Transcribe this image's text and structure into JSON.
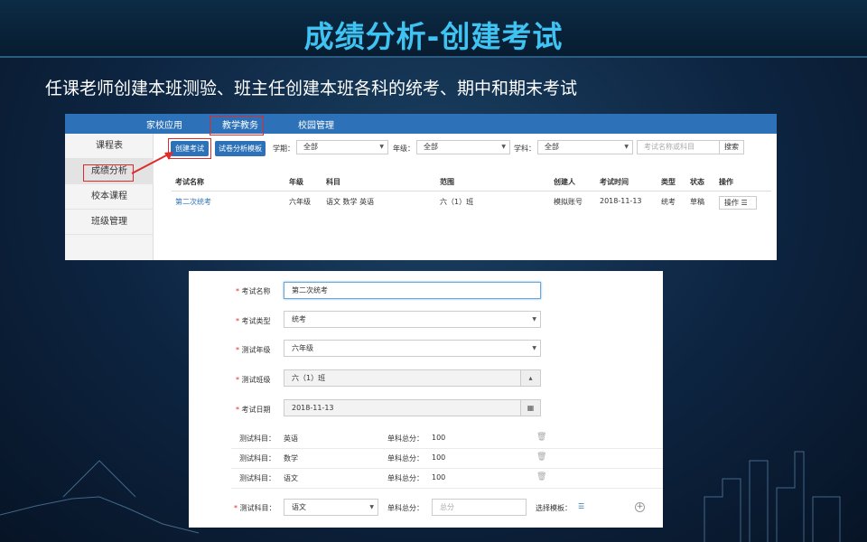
{
  "slide": {
    "title": "成绩分析-创建考试",
    "subtitle": "任课老师创建本班测验、班主任创建本班各科的统考、期中和期末考试"
  },
  "shot1": {
    "nav": [
      "家校应用",
      "教学教务",
      "校园管理"
    ],
    "sidebar": [
      "课程表",
      "成绩分析",
      "校本课程",
      "班级管理"
    ],
    "buttons": {
      "create": "创建考试",
      "template": "试卷分析模板",
      "search": "搜索"
    },
    "filters": {
      "semester_label": "学期：",
      "semester_value": "全部",
      "grade_label": "年级：",
      "grade_value": "全部",
      "subject_label": "学科：",
      "subject_value": "全部",
      "search_placeholder": "考试名称或科目"
    },
    "table": {
      "headers": [
        "考试名称",
        "年级",
        "科目",
        "范围",
        "创建人",
        "考试时间",
        "类型",
        "状态",
        "操作"
      ],
      "rows": [
        [
          "第二次统考",
          "六年级",
          "语文 数学 英语",
          "六（1）班",
          "模拟账号",
          "2018-11-13",
          "统考",
          "草稿"
        ]
      ],
      "op_label": "操作"
    }
  },
  "shot2": {
    "fields": [
      {
        "label": "考试名称",
        "value": "第二次统考"
      },
      {
        "label": "考试类型",
        "value": "统考"
      },
      {
        "label": "测试年级",
        "value": "六年级"
      },
      {
        "label": "测试班级",
        "value": "六（1）班"
      },
      {
        "label": "考试日期",
        "value": "2018-11-13"
      }
    ],
    "subject_rows": [
      {
        "subject_label": "测试科目：",
        "subject": "英语",
        "score_label": "单科总分：",
        "score": "100"
      },
      {
        "subject_label": "测试科目：",
        "subject": "数学",
        "score_label": "单科总分：",
        "score": "100"
      },
      {
        "subject_label": "测试科目：",
        "subject": "语文",
        "score_label": "单科总分：",
        "score": "100"
      }
    ],
    "new_row": {
      "subject_label": "测试科目：",
      "subject_value": "语文",
      "score_label": "单科总分：",
      "score_placeholder": "总分",
      "template_label": "选择模板："
    },
    "accent": "#2d72b8"
  }
}
